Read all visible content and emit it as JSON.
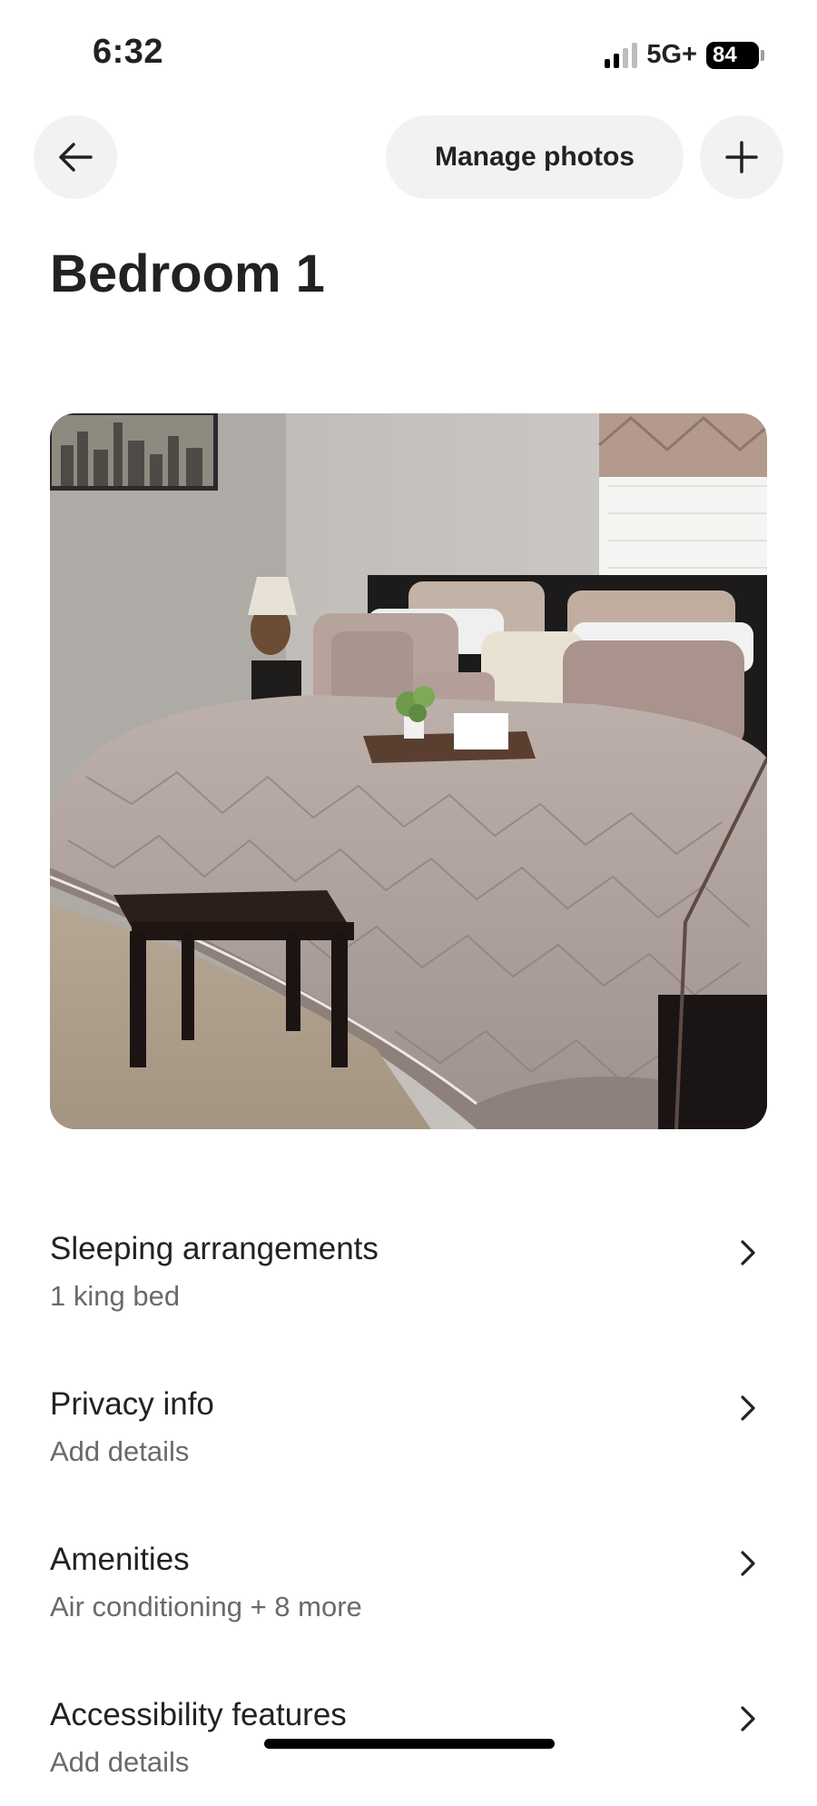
{
  "status_bar": {
    "time": "6:32",
    "network": "5G+",
    "battery": "84"
  },
  "header": {
    "back_icon": "arrow-left-icon",
    "manage_photos_label": "Manage photos",
    "add_icon": "plus-icon"
  },
  "page": {
    "title": "Bedroom 1"
  },
  "photo": {
    "subject": "bedroom-photo"
  },
  "settings": [
    {
      "title": "Sleeping arrangements",
      "subtitle": "1 king bed"
    },
    {
      "title": "Privacy info",
      "subtitle": "Add details"
    },
    {
      "title": "Amenities",
      "subtitle": "Air conditioning + 8 more"
    },
    {
      "title": "Accessibility features",
      "subtitle": "Add details"
    }
  ],
  "colors": {
    "button_bg": "#f2f2f2",
    "text_primary": "#222222",
    "text_secondary": "#6a6a6a"
  }
}
